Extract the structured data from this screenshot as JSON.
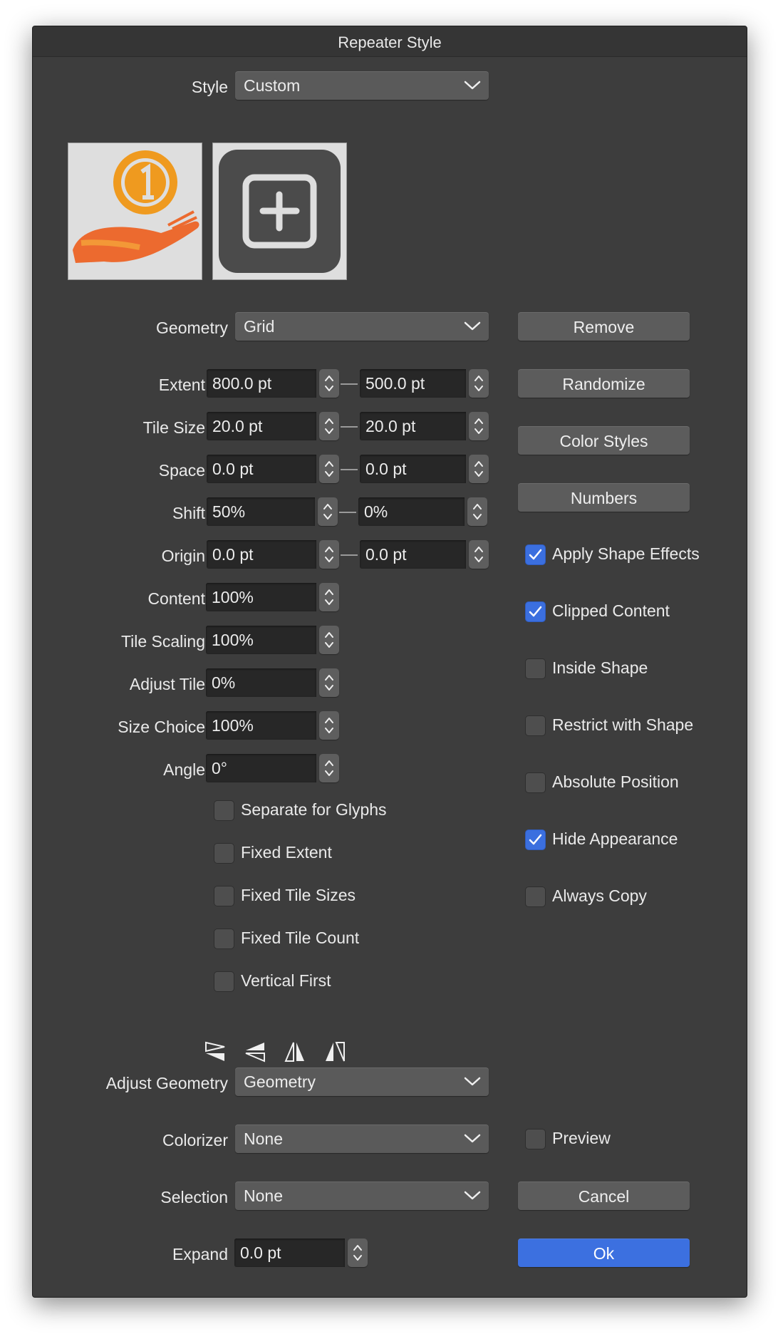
{
  "window": {
    "title": "Repeater Style"
  },
  "style": {
    "label": "Style",
    "value": "Custom"
  },
  "thumbnails": [
    {
      "icon": "hand-coin-icon"
    },
    {
      "icon": "add-plus-icon"
    }
  ],
  "geometry": {
    "label": "Geometry",
    "value": "Grid"
  },
  "rows": {
    "extent": {
      "label": "Extent",
      "a": "800.0 pt",
      "b": "500.0 pt"
    },
    "tile_size": {
      "label": "Tile Size",
      "a": "20.0 pt",
      "b": "20.0 pt"
    },
    "space": {
      "label": "Space",
      "a": "0.0 pt",
      "b": "0.0 pt"
    },
    "shift": {
      "label": "Shift",
      "a": "50%",
      "b": "0%"
    },
    "origin": {
      "label": "Origin",
      "a": "0.0 pt",
      "b": "0.0 pt"
    },
    "content": {
      "label": "Content",
      "a": "100%"
    },
    "tile_scaling": {
      "label": "Tile Scaling",
      "a": "100%"
    },
    "adjust_tile": {
      "label": "Adjust Tile",
      "a": "0%"
    },
    "size_choice": {
      "label": "Size Choice",
      "a": "100%"
    },
    "angle": {
      "label": "Angle",
      "a": "0°"
    }
  },
  "left_checks": [
    {
      "label": "Separate for Glyphs",
      "checked": false
    },
    {
      "label": "Fixed Extent",
      "checked": false
    },
    {
      "label": "Fixed Tile Sizes",
      "checked": false
    },
    {
      "label": "Fixed Tile Count",
      "checked": false
    },
    {
      "label": "Vertical First",
      "checked": false
    }
  ],
  "flip_icons": [
    "flip-top-icon",
    "flip-bottom-icon",
    "flip-left-icon",
    "flip-right-icon"
  ],
  "buttons": {
    "remove": "Remove",
    "randomize": "Randomize",
    "color_styles": "Color Styles",
    "numbers": "Numbers",
    "cancel": "Cancel",
    "ok": "Ok"
  },
  "right_checks": [
    {
      "label": "Apply Shape Effects",
      "checked": true
    },
    {
      "label": "Clipped Content",
      "checked": true
    },
    {
      "label": "Inside Shape",
      "checked": false
    },
    {
      "label": "Restrict with Shape",
      "checked": false
    },
    {
      "label": "Absolute Position",
      "checked": false
    },
    {
      "label": "Hide Appearance",
      "checked": true
    },
    {
      "label": "Always Copy",
      "checked": false
    }
  ],
  "adjust_geometry": {
    "label": "Adjust Geometry",
    "value": "Geometry"
  },
  "colorizer": {
    "label": "Colorizer",
    "value": "None"
  },
  "selection": {
    "label": "Selection",
    "value": "None"
  },
  "preview": {
    "label": "Preview",
    "checked": false
  },
  "expand": {
    "label": "Expand",
    "value": "0.0 pt"
  },
  "colors": {
    "background": "#3d3d3d",
    "accent": "#3b6fdf",
    "field": "#272727",
    "control": "#5a5a5a"
  }
}
